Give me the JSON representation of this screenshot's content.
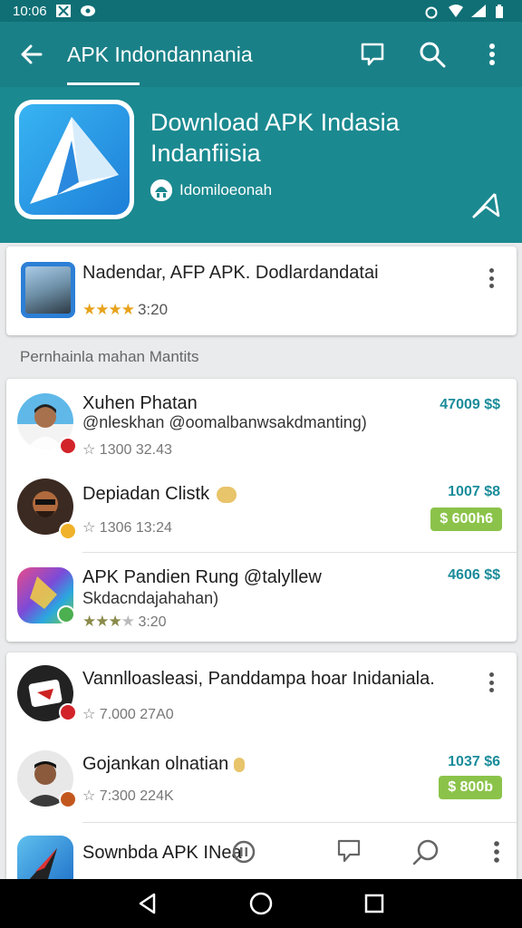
{
  "status_bar": {
    "time": "10:06"
  },
  "app_bar": {
    "title": "APK Indondannania"
  },
  "header": {
    "title": "Download APK Indasia Indanfiisia",
    "developer": "Idomiloeonah"
  },
  "featured": {
    "title": "Nadendar, AFP APK. Dodlardandatai",
    "rating_stars": "★★★★",
    "rating_text": "3:20"
  },
  "section_label": "Pernhainla mahan Mantits",
  "list1": [
    {
      "name": "Xuhen Phatan",
      "sub": "@nleskhan @oomalbanwsakdmanting)",
      "meta": "☆ 1300 32.43",
      "count": "47009 $$"
    },
    {
      "name": "Depiadan Clistk",
      "meta": "☆ 1306 13:24",
      "count": "1007 $8",
      "price": "$ 600h6"
    },
    {
      "name": "APK Pandien Rung @talyllew",
      "sub": "Skdacndajahahan)",
      "meta_stars": "★★★",
      "meta_stars_off": "★",
      "meta": "3:20",
      "count": "4606 $$"
    }
  ],
  "list2": [
    {
      "name": "Vannlloasleasi, Panddampa hoar Inidaniala.",
      "meta": "☆ 7.000 27A0"
    },
    {
      "name": "Gojankan olnatian",
      "meta": "☆ 7:300 224K",
      "count": "1037 $6",
      "price": "$ 800b"
    },
    {
      "name": "Sownbda APK INea"
    }
  ],
  "colors": {
    "primary": "#1a8087",
    "header": "#1b8990",
    "accent_count": "#1a8c9a",
    "price_bg": "#8bc34a",
    "star": "#e8a21b"
  },
  "icons": {
    "back": "arrow-left-icon",
    "chat": "chat-icon",
    "search": "search-icon",
    "more": "more-vert-icon",
    "share": "share-icon"
  }
}
